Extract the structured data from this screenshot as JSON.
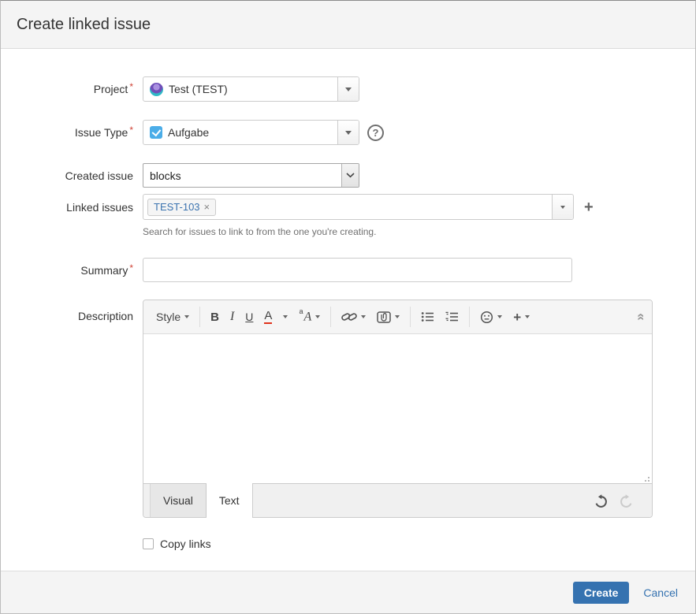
{
  "window": {
    "title": "Create linked issue"
  },
  "icons": {
    "required_marker": "*",
    "remove_x": "×",
    "help_question": "?",
    "add_plus": "+"
  },
  "form": {
    "project": {
      "label": "Project",
      "value": "Test (TEST)"
    },
    "issue_type": {
      "label": "Issue Type",
      "value": "Aufgabe"
    },
    "created_issue": {
      "label": "Created issue",
      "value": "blocks"
    },
    "linked_issues": {
      "label": "Linked issues",
      "tag": "TEST-103",
      "help": "Search for issues to link to from the one you're creating."
    },
    "summary": {
      "label": "Summary",
      "value": ""
    },
    "description": {
      "label": "Description"
    }
  },
  "editor": {
    "style": "Style",
    "bold": "B",
    "italic": "I",
    "underline": "U",
    "text_color": "A",
    "font_sup": "a",
    "font_main": "A",
    "tabs": {
      "visual": "Visual",
      "text": "Text"
    }
  },
  "options": {
    "copy_links": "Copy links"
  },
  "footer": {
    "create": "Create",
    "cancel": "Cancel"
  },
  "colors": {
    "accent": "#3572b0",
    "required": "#d04437",
    "task_icon": "#4bade8",
    "tag_text": "#3b73af",
    "header_bg": "#f4f4f4",
    "color_button_underline": "#e0321c"
  }
}
